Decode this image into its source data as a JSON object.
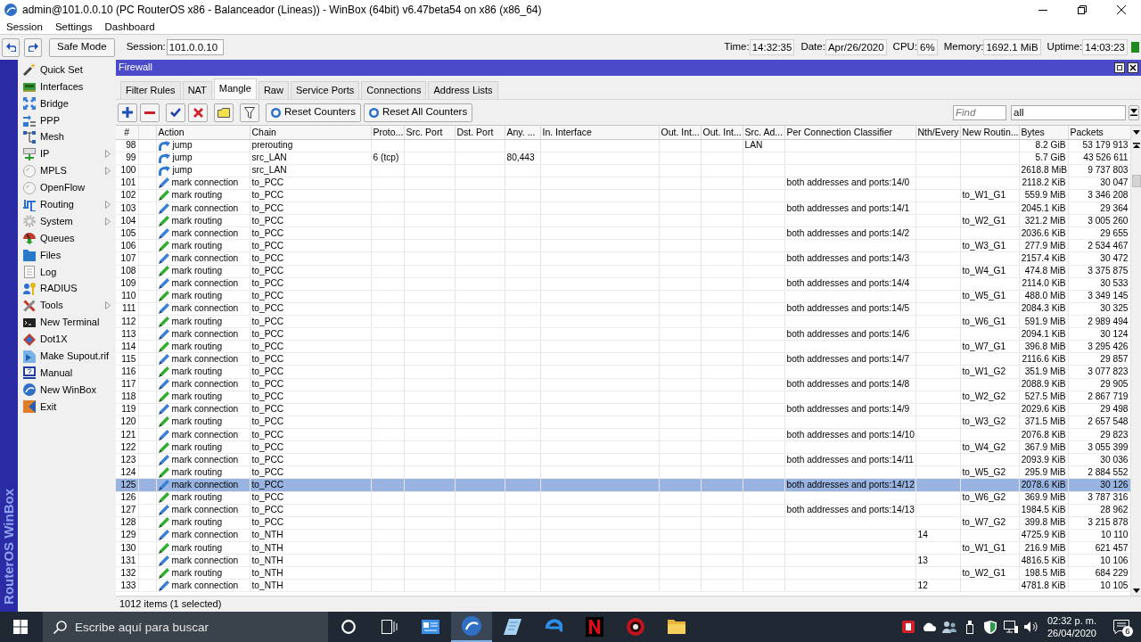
{
  "window": {
    "title": "admin@101.0.0.10 (PC RouterOS x86 - Balanceador (Lineas)) - WinBox (64bit) v6.47beta54 on x86 (x86_64)"
  },
  "menu": [
    "Session",
    "Settings",
    "Dashboard"
  ],
  "toolbar": {
    "safe_mode": "Safe Mode",
    "session_label": "Session:",
    "session": "101.0.0.10",
    "stats": [
      {
        "label": "Time:",
        "value": "14:32:35"
      },
      {
        "label": "Date:",
        "value": "Apr/26/2020"
      },
      {
        "label": "CPU:",
        "value": "6%"
      },
      {
        "label": "Memory:",
        "value": "1692.1 MiB"
      },
      {
        "label": "Uptime:",
        "value": "14:03:23"
      }
    ]
  },
  "side_strip": "RouterOS WinBox",
  "sidebar": {
    "items": [
      {
        "label": "Quick Set",
        "submenu": false
      },
      {
        "label": "Interfaces",
        "submenu": false
      },
      {
        "label": "Bridge",
        "submenu": false
      },
      {
        "label": "PPP",
        "submenu": false
      },
      {
        "label": "Mesh",
        "submenu": false
      },
      {
        "label": "IP",
        "submenu": true
      },
      {
        "label": "MPLS",
        "submenu": true
      },
      {
        "label": "OpenFlow",
        "submenu": false
      },
      {
        "label": "Routing",
        "submenu": true
      },
      {
        "label": "System",
        "submenu": true
      },
      {
        "label": "Queues",
        "submenu": false
      },
      {
        "label": "Files",
        "submenu": false
      },
      {
        "label": "Log",
        "submenu": false
      },
      {
        "label": "RADIUS",
        "submenu": false
      },
      {
        "label": "Tools",
        "submenu": true
      },
      {
        "label": "New Terminal",
        "submenu": false
      },
      {
        "label": "Dot1X",
        "submenu": false
      },
      {
        "label": "Make Supout.rif",
        "submenu": false
      },
      {
        "label": "Manual",
        "submenu": false
      },
      {
        "label": "New WinBox",
        "submenu": false
      },
      {
        "label": "Exit",
        "submenu": false
      }
    ]
  },
  "firewall": {
    "title": "Firewall",
    "tabs": [
      {
        "label": "Filter Rules",
        "selected": false
      },
      {
        "label": "NAT",
        "selected": false
      },
      {
        "label": "Mangle",
        "selected": true
      },
      {
        "label": "Raw",
        "selected": false
      },
      {
        "label": "Service Ports",
        "selected": false
      },
      {
        "label": "Connections",
        "selected": false
      },
      {
        "label": "Address Lists",
        "selected": false
      }
    ],
    "toolbar": {
      "buttons": [
        "Reset Counters",
        "Reset All Counters"
      ],
      "find": {
        "placeholder": "Find"
      },
      "filter": {
        "value": "all"
      }
    },
    "table": {
      "columns": [
        "#",
        "Action",
        "Chain",
        "Proto...",
        "Src. Port",
        "Dst. Port",
        "Any. ...",
        "In. Interface",
        "Out. Int...",
        "Out. Int...",
        "Src. Ad...",
        "Per Connection Classifier",
        "Nth/Every",
        "New Routin...",
        "Bytes",
        "Packets"
      ],
      "rows": [
        {
          "number": "98",
          "kind": "jump",
          "action": "jump",
          "chain": "prerouting",
          "column_12": "LAN",
          "bytes": "8.2 GiB",
          "packets": "53 179 913",
          "selected": false
        },
        {
          "number": "99",
          "kind": "jump",
          "action": "jump",
          "chain": "src_LAN",
          "column_5": "6 (tcp)",
          "column_8": "80,443",
          "bytes": "5.7 GiB",
          "packets": "43 526 611",
          "selected": false
        },
        {
          "number": "100",
          "kind": "jump",
          "action": "jump",
          "chain": "src_LAN",
          "bytes": "2618.8 MiB",
          "packets": "9 737 803",
          "selected": false
        },
        {
          "number": "101",
          "kind": "connection",
          "action": "mark connection",
          "chain": "to_PCC",
          "per_connection_classifier": "both addresses and ports:14/0",
          "bytes": "2118.2 KiB",
          "packets": "30 047",
          "selected": false
        },
        {
          "number": "102",
          "kind": "routing",
          "action": "mark routing",
          "chain": "to_PCC",
          "column_15": "to_W1_G1",
          "bytes": "559.9 MiB",
          "packets": "3 346 208",
          "selected": false
        },
        {
          "number": "103",
          "kind": "connection",
          "action": "mark connection",
          "chain": "to_PCC",
          "per_connection_classifier": "both addresses and ports:14/1",
          "bytes": "2045.1 KiB",
          "packets": "29 364",
          "selected": false
        },
        {
          "number": "104",
          "kind": "routing",
          "action": "mark routing",
          "chain": "to_PCC",
          "column_15": "to_W2_G1",
          "bytes": "321.2 MiB",
          "packets": "3 005 260",
          "selected": false
        },
        {
          "number": "105",
          "kind": "connection",
          "action": "mark connection",
          "chain": "to_PCC",
          "per_connection_classifier": "both addresses and ports:14/2",
          "bytes": "2036.6 KiB",
          "packets": "29 655",
          "selected": false
        },
        {
          "number": "106",
          "kind": "routing",
          "action": "mark routing",
          "chain": "to_PCC",
          "column_15": "to_W3_G1",
          "bytes": "277.9 MiB",
          "packets": "2 534 467",
          "selected": false
        },
        {
          "number": "107",
          "kind": "connection",
          "action": "mark connection",
          "chain": "to_PCC",
          "per_connection_classifier": "both addresses and ports:14/3",
          "bytes": "2157.4 KiB",
          "packets": "30 472",
          "selected": false
        },
        {
          "number": "108",
          "kind": "routing",
          "action": "mark routing",
          "chain": "to_PCC",
          "column_15": "to_W4_G1",
          "bytes": "474.8 MiB",
          "packets": "3 375 875",
          "selected": false
        },
        {
          "number": "109",
          "kind": "connection",
          "action": "mark connection",
          "chain": "to_PCC",
          "per_connection_classifier": "both addresses and ports:14/4",
          "bytes": "2114.0 KiB",
          "packets": "30 533",
          "selected": false
        },
        {
          "number": "110",
          "kind": "routing",
          "action": "mark routing",
          "chain": "to_PCC",
          "column_15": "to_W5_G1",
          "bytes": "488.0 MiB",
          "packets": "3 349 145",
          "selected": false
        },
        {
          "number": "111",
          "kind": "connection",
          "action": "mark connection",
          "chain": "to_PCC",
          "per_connection_classifier": "both addresses and ports:14/5",
          "bytes": "2084.3 KiB",
          "packets": "30 325",
          "selected": false
        },
        {
          "number": "112",
          "kind": "routing",
          "action": "mark routing",
          "chain": "to_PCC",
          "column_15": "to_W6_G1",
          "bytes": "591.9 MiB",
          "packets": "2 989 494",
          "selected": false
        },
        {
          "number": "113",
          "kind": "connection",
          "action": "mark connection",
          "chain": "to_PCC",
          "per_connection_classifier": "both addresses and ports:14/6",
          "bytes": "2094.1 KiB",
          "packets": "30 124",
          "selected": false
        },
        {
          "number": "114",
          "kind": "routing",
          "action": "mark routing",
          "chain": "to_PCC",
          "column_15": "to_W7_G1",
          "bytes": "396.8 MiB",
          "packets": "3 295 426",
          "selected": false
        },
        {
          "number": "115",
          "kind": "connection",
          "action": "mark connection",
          "chain": "to_PCC",
          "per_connection_classifier": "both addresses and ports:14/7",
          "bytes": "2116.6 KiB",
          "packets": "29 857",
          "selected": false
        },
        {
          "number": "116",
          "kind": "routing",
          "action": "mark routing",
          "chain": "to_PCC",
          "column_15": "to_W1_G2",
          "bytes": "351.9 MiB",
          "packets": "3 077 823",
          "selected": false
        },
        {
          "number": "117",
          "kind": "connection",
          "action": "mark connection",
          "chain": "to_PCC",
          "per_connection_classifier": "both addresses and ports:14/8",
          "bytes": "2088.9 KiB",
          "packets": "29 905",
          "selected": false
        },
        {
          "number": "118",
          "kind": "routing",
          "action": "mark routing",
          "chain": "to_PCC",
          "column_15": "to_W2_G2",
          "bytes": "527.5 MiB",
          "packets": "2 867 719",
          "selected": false
        },
        {
          "number": "119",
          "kind": "connection",
          "action": "mark connection",
          "chain": "to_PCC",
          "per_connection_classifier": "both addresses and ports:14/9",
          "bytes": "2029.6 KiB",
          "packets": "29 498",
          "selected": false
        },
        {
          "number": "120",
          "kind": "routing",
          "action": "mark routing",
          "chain": "to_PCC",
          "column_15": "to_W3_G2",
          "bytes": "371.5 MiB",
          "packets": "2 657 548",
          "selected": false
        },
        {
          "number": "121",
          "kind": "connection",
          "action": "mark connection",
          "chain": "to_PCC",
          "per_connection_classifier": "both addresses and ports:14/10",
          "bytes": "2076.8 KiB",
          "packets": "29 823",
          "selected": false
        },
        {
          "number": "122",
          "kind": "routing",
          "action": "mark routing",
          "chain": "to_PCC",
          "column_15": "to_W4_G2",
          "bytes": "367.9 MiB",
          "packets": "3 055 399",
          "selected": false
        },
        {
          "number": "123",
          "kind": "connection",
          "action": "mark connection",
          "chain": "to_PCC",
          "per_connection_classifier": "both addresses and ports:14/11",
          "bytes": "2093.9 KiB",
          "packets": "30 036",
          "selected": false
        },
        {
          "number": "124",
          "kind": "routing",
          "action": "mark routing",
          "chain": "to_PCC",
          "column_15": "to_W5_G2",
          "bytes": "295.9 MiB",
          "packets": "2 884 552",
          "selected": false
        },
        {
          "number": "125",
          "kind": "connection",
          "action": "mark connection",
          "chain": "to_PCC",
          "per_connection_classifier": "both addresses and ports:14/12",
          "bytes": "2078.6 KiB",
          "packets": "30 126",
          "selected": true
        },
        {
          "number": "126",
          "kind": "routing",
          "action": "mark routing",
          "chain": "to_PCC",
          "column_15": "to_W6_G2",
          "bytes": "369.9 MiB",
          "packets": "3 787 316",
          "selected": false
        },
        {
          "number": "127",
          "kind": "connection",
          "action": "mark connection",
          "chain": "to_PCC",
          "per_connection_classifier": "both addresses and ports:14/13",
          "bytes": "1984.5 KiB",
          "packets": "28 962",
          "selected": false
        },
        {
          "number": "128",
          "kind": "routing",
          "action": "mark routing",
          "chain": "to_PCC",
          "column_15": "to_W7_G2",
          "bytes": "399.8 MiB",
          "packets": "3 215 878",
          "selected": false
        },
        {
          "number": "129",
          "kind": "connection",
          "action": "mark connection",
          "chain": "to_NTH",
          "nth_every": "14",
          "bytes": "4725.9 KiB",
          "packets": "10 110",
          "selected": false
        },
        {
          "number": "130",
          "kind": "routing",
          "action": "mark routing",
          "chain": "to_NTH",
          "column_15": "to_W1_G1",
          "bytes": "216.9 MiB",
          "packets": "621 457",
          "selected": false
        },
        {
          "number": "131",
          "kind": "connection",
          "action": "mark connection",
          "chain": "to_NTH",
          "nth_every": "13",
          "bytes": "4816.5 KiB",
          "packets": "10 106",
          "selected": false
        },
        {
          "number": "132",
          "kind": "routing",
          "action": "mark routing",
          "chain": "to_NTH",
          "column_15": "to_W2_G1",
          "bytes": "198.5 MiB",
          "packets": "684 229",
          "selected": false
        },
        {
          "number": "133",
          "kind": "connection",
          "action": "mark connection",
          "chain": "to_NTH",
          "nth_every": "12",
          "bytes": "4781.8 KiB",
          "packets": "10 105",
          "selected": false
        }
      ]
    },
    "status": "1012 items (1 selected)"
  },
  "taskbar": {
    "search": {
      "placeholder": "Escribe aquí para buscar"
    },
    "time": "02:32 p. m.",
    "date": "26/04/2020",
    "notifications": "6"
  }
}
